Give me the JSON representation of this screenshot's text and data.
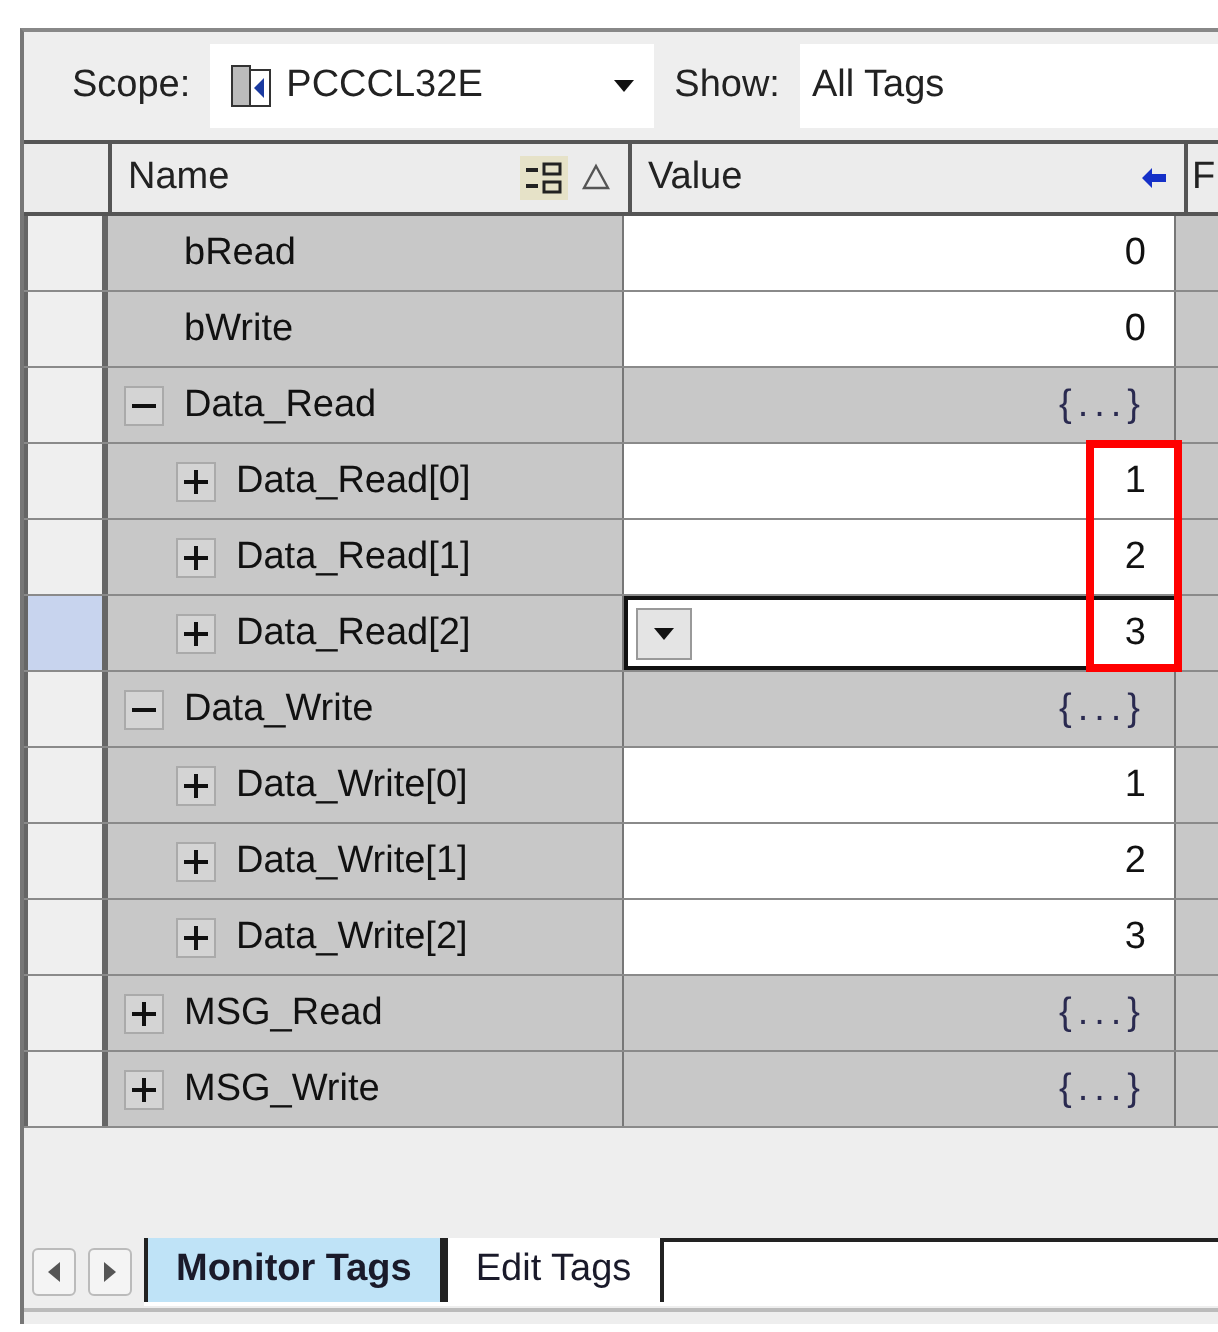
{
  "toolbar": {
    "scope_label": "Scope:",
    "scope": "PCCCL32E",
    "show_label": "Show:",
    "show": "All Tags"
  },
  "columns": [
    {
      "label": "Name"
    },
    {
      "label": "Value"
    },
    {
      "label": "F"
    }
  ],
  "rows": [
    {
      "name": "bRead",
      "kind": "scalar",
      "value": "0",
      "selected": false,
      "highlighted": false
    },
    {
      "name": "bWrite",
      "kind": "scalar",
      "value": "0",
      "selected": false,
      "highlighted": false
    },
    {
      "name": "Data_Read",
      "kind": "struct",
      "value": "{...}",
      "expanded": true,
      "selected": false,
      "highlighted": false,
      "children": [
        {
          "name": "Data_Read[0]",
          "kind": "scalar",
          "value": "1",
          "expanded": false,
          "selected": false,
          "highlighted": true
        },
        {
          "name": "Data_Read[1]",
          "kind": "scalar",
          "value": "2",
          "expanded": false,
          "selected": false,
          "highlighted": true
        },
        {
          "name": "Data_Read[2]",
          "kind": "scalar",
          "value": "3",
          "expanded": false,
          "selected": true,
          "highlighted": true
        }
      ]
    },
    {
      "name": "Data_Write",
      "kind": "struct",
      "value": "{...}",
      "expanded": true,
      "selected": false,
      "highlighted": false,
      "children": [
        {
          "name": "Data_Write[0]",
          "kind": "scalar",
          "value": "1",
          "expanded": false,
          "selected": false,
          "highlighted": false
        },
        {
          "name": "Data_Write[1]",
          "kind": "scalar",
          "value": "2",
          "expanded": false,
          "selected": false,
          "highlighted": false
        },
        {
          "name": "Data_Write[2]",
          "kind": "scalar",
          "value": "3",
          "expanded": false,
          "selected": false,
          "highlighted": false
        }
      ]
    },
    {
      "name": "MSG_Read",
      "kind": "struct",
      "value": "{...}",
      "expanded": false,
      "selected": false,
      "highlighted": false
    },
    {
      "name": "MSG_Write",
      "kind": "struct",
      "value": "{...}",
      "expanded": false,
      "selected": false,
      "highlighted": false
    }
  ],
  "tabs": [
    {
      "label": "Monitor Tags",
      "selected": true
    },
    {
      "label": "Edit Tags",
      "selected": false
    }
  ]
}
